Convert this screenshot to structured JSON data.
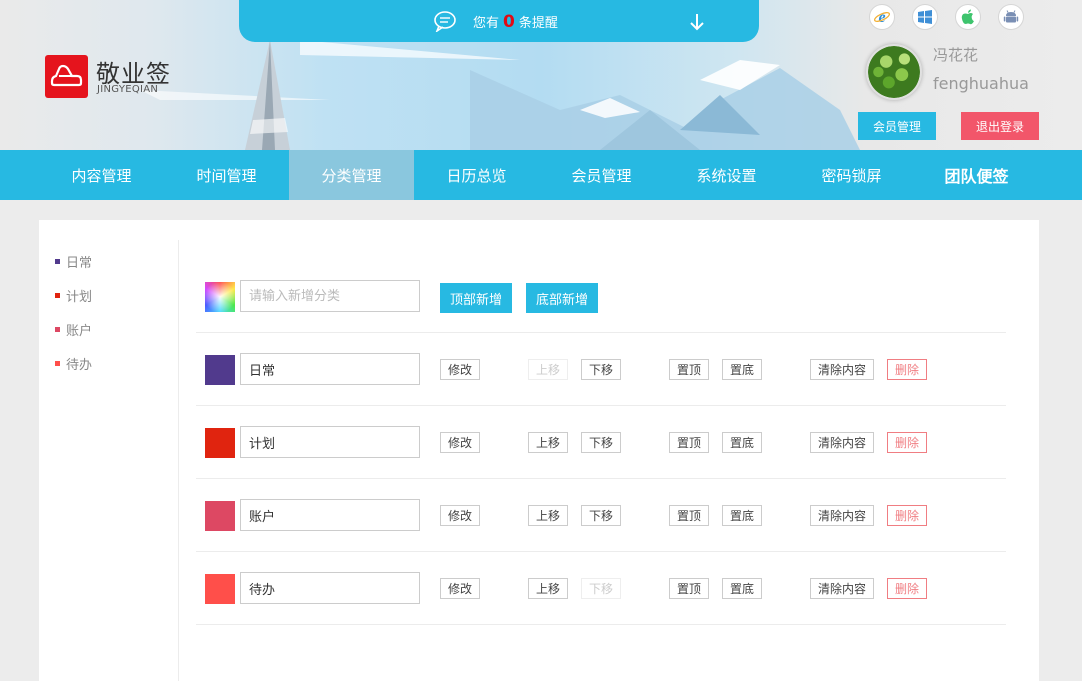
{
  "notice": {
    "prefix": "您有",
    "count": "0",
    "suffix": "条提醒"
  },
  "brand": {
    "name": "敬业签",
    "sub": "JINGYEQIAN"
  },
  "platforms": [
    "ie-icon",
    "windows-icon",
    "apple-icon",
    "android-icon"
  ],
  "user": {
    "name_cn": "冯花花",
    "name_en": "fenghuahua",
    "member_btn": "会员管理",
    "logout_btn": "退出登录"
  },
  "nav": {
    "items": [
      "内容管理",
      "时间管理",
      "分类管理",
      "日历总览",
      "会员管理",
      "系统设置",
      "密码锁屏",
      "团队便签"
    ],
    "active": "分类管理"
  },
  "sidebar": {
    "items": [
      {
        "label": "日常",
        "color": "#513a8d"
      },
      {
        "label": "计划",
        "color": "#e0240f"
      },
      {
        "label": "账户",
        "color": "#dd4863"
      },
      {
        "label": "待办",
        "color": "#ff4f4a"
      }
    ]
  },
  "add_row": {
    "placeholder": "请输入新增分类",
    "add_top": "顶部新增",
    "add_bottom": "底部新增"
  },
  "actions": {
    "edit": "修改",
    "up": "上移",
    "down": "下移",
    "top": "置顶",
    "bottom": "置底",
    "clear": "清除内容",
    "delete": "删除"
  },
  "categories": [
    {
      "name": "日常",
      "color": "#513a8d",
      "up_disabled": true,
      "down_disabled": false
    },
    {
      "name": "计划",
      "color": "#e0240f",
      "up_disabled": false,
      "down_disabled": false
    },
    {
      "name": "账户",
      "color": "#dd4863",
      "up_disabled": false,
      "down_disabled": false
    },
    {
      "name": "待办",
      "color": "#ff4f4a",
      "up_disabled": false,
      "down_disabled": true
    }
  ]
}
